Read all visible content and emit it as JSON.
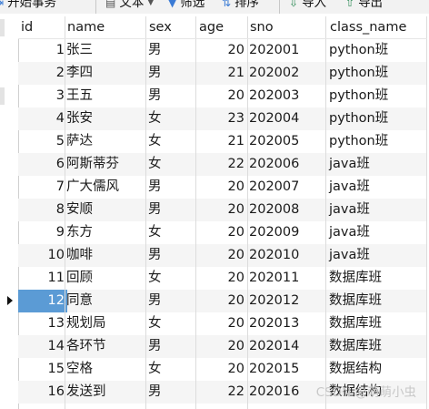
{
  "toolbar": {
    "items": [
      {
        "label": "开始事务",
        "icon": "transaction-icon"
      },
      {
        "label": "文本",
        "icon": "text-icon"
      },
      {
        "label": "筛选",
        "icon": "filter-icon"
      },
      {
        "label": "排序",
        "icon": "sort-icon"
      },
      {
        "label": "导入",
        "icon": "import-icon"
      },
      {
        "label": "导出",
        "icon": "export-icon"
      }
    ]
  },
  "table": {
    "columns": [
      "id",
      "name",
      "sex",
      "age",
      "sno",
      "class_name"
    ],
    "rows": [
      {
        "id": "1",
        "name": "张三",
        "sex": "男",
        "age": "20",
        "sno": "202001",
        "class_name": "python班"
      },
      {
        "id": "2",
        "name": "李四",
        "sex": "男",
        "age": "21",
        "sno": "202002",
        "class_name": "python班"
      },
      {
        "id": "3",
        "name": "王五",
        "sex": "男",
        "age": "20",
        "sno": "202003",
        "class_name": "python班"
      },
      {
        "id": "4",
        "name": "张安",
        "sex": "女",
        "age": "23",
        "sno": "202004",
        "class_name": "python班"
      },
      {
        "id": "5",
        "name": "萨达",
        "sex": "女",
        "age": "21",
        "sno": "202005",
        "class_name": "python班"
      },
      {
        "id": "6",
        "name": "阿斯蒂芬",
        "sex": "女",
        "age": "22",
        "sno": "202006",
        "class_name": "java班"
      },
      {
        "id": "7",
        "name": "广大儒风",
        "sex": "男",
        "age": "20",
        "sno": "202007",
        "class_name": "java班"
      },
      {
        "id": "8",
        "name": "安顺",
        "sex": "男",
        "age": "20",
        "sno": "202008",
        "class_name": "java班"
      },
      {
        "id": "9",
        "name": "东方",
        "sex": "女",
        "age": "20",
        "sno": "202009",
        "class_name": "java班"
      },
      {
        "id": "10",
        "name": "咖啡",
        "sex": "男",
        "age": "20",
        "sno": "202010",
        "class_name": "java班"
      },
      {
        "id": "11",
        "name": "回顾",
        "sex": "女",
        "age": "20",
        "sno": "202011",
        "class_name": "数据库班"
      },
      {
        "id": "12",
        "name": "同意",
        "sex": "男",
        "age": "20",
        "sno": "202012",
        "class_name": "数据库班"
      },
      {
        "id": "13",
        "name": "规划局",
        "sex": "女",
        "age": "20",
        "sno": "202013",
        "class_name": "数据库班"
      },
      {
        "id": "14",
        "name": "各环节",
        "sex": "男",
        "age": "20",
        "sno": "202014",
        "class_name": "数据库班"
      },
      {
        "id": "15",
        "name": "空格",
        "sex": "女",
        "age": "20",
        "sno": "202015",
        "class_name": "数据结构"
      },
      {
        "id": "16",
        "name": "发送到",
        "sex": "男",
        "age": "22",
        "sno": "202016",
        "class_name": "数据结构"
      }
    ],
    "selected_row_id": "12"
  },
  "watermark": "CSDN @萌萌小虫",
  "colors": {
    "selection": "#5b9bd5",
    "alt_row": "#f5f5f5",
    "toolbar_bg": "#f2f2f2"
  }
}
